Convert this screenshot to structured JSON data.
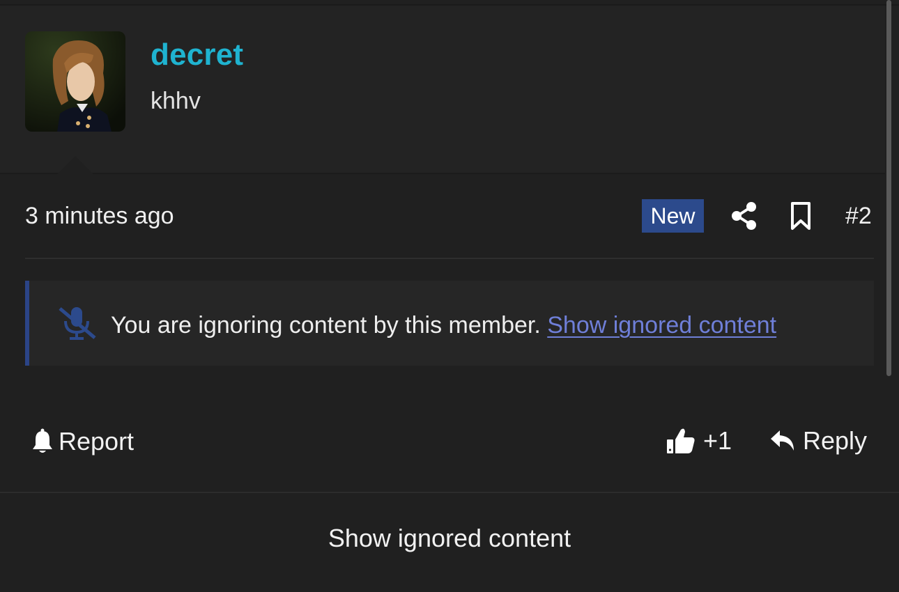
{
  "post": {
    "author": {
      "username": "decret",
      "title": "khhv",
      "avatar_alt": "user avatar"
    },
    "timestamp": "3 minutes ago",
    "badge": "New",
    "post_number": "#2",
    "notice": {
      "text": "You are ignoring content by this member.",
      "link_label": "Show ignored content"
    },
    "actions": {
      "report_label": "Report",
      "like_count": "+1",
      "reply_label": "Reply"
    }
  },
  "footer": {
    "show_ignored_label": "Show ignored content"
  },
  "colors": {
    "background": "#202020",
    "username": "#1fb3d0",
    "badge": "#2c4a8c",
    "link": "#6f7fd8",
    "notice_border": "#2b4487"
  },
  "icons": {
    "share": "share-icon",
    "bookmark": "bookmark-icon",
    "mute": "microphone-slash-icon",
    "report": "bell-icon",
    "like": "thumbs-up-icon",
    "reply": "reply-arrow-icon"
  }
}
